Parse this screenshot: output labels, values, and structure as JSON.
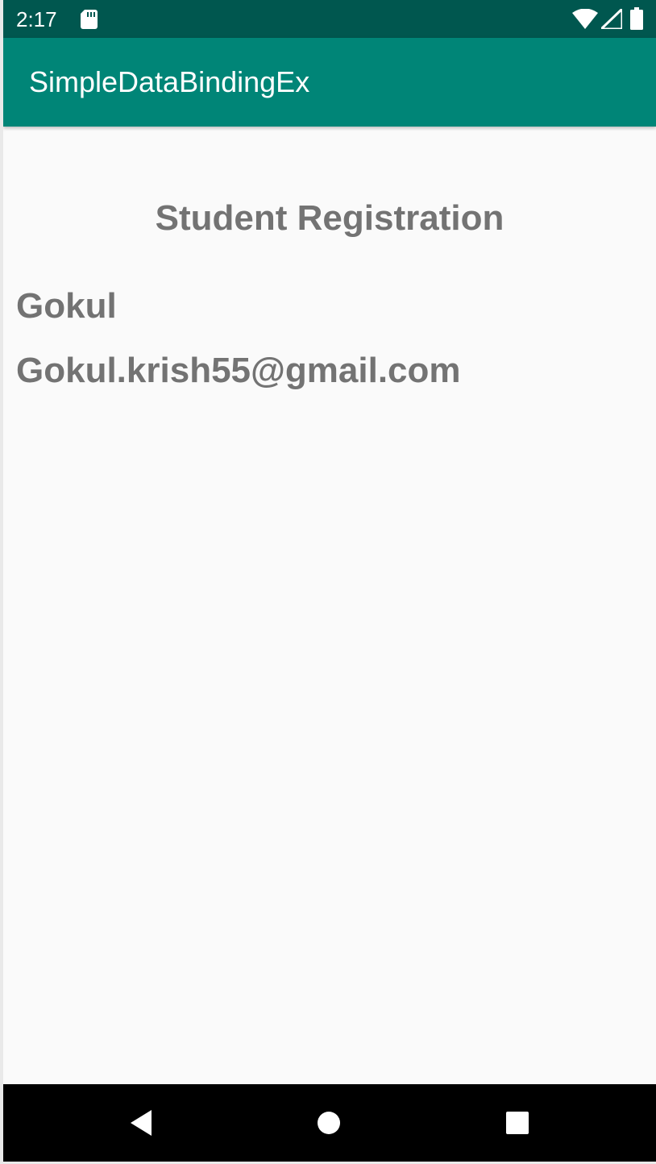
{
  "status_bar": {
    "time": "2:17",
    "icons": [
      "sd-card-icon",
      "wifi-icon",
      "cell-signal-icon",
      "battery-icon"
    ],
    "background": "#00574f"
  },
  "app_bar": {
    "title": "SimpleDataBindingEx",
    "background": "#008577"
  },
  "main": {
    "heading": "Student Registration",
    "student": {
      "name": "Gokul",
      "email": "Gokul.krish55@gmail.com"
    },
    "text_color": "#737373",
    "background": "#fafafa"
  },
  "nav_bar": {
    "buttons": [
      "back-icon",
      "home-icon",
      "recents-icon"
    ]
  }
}
